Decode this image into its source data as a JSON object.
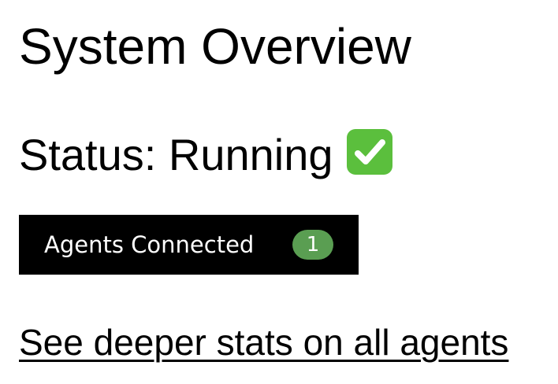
{
  "page": {
    "title": "System Overview"
  },
  "status": {
    "text": "Status: Running",
    "icon": "check-mark-button-icon",
    "icon_color": "#5bbf3d"
  },
  "agents": {
    "label": "Agents Connected",
    "count": "1",
    "button_color": "#000000",
    "badge_color": "#5a9e52"
  },
  "links": {
    "deeper_stats": "See deeper stats on all agents"
  }
}
